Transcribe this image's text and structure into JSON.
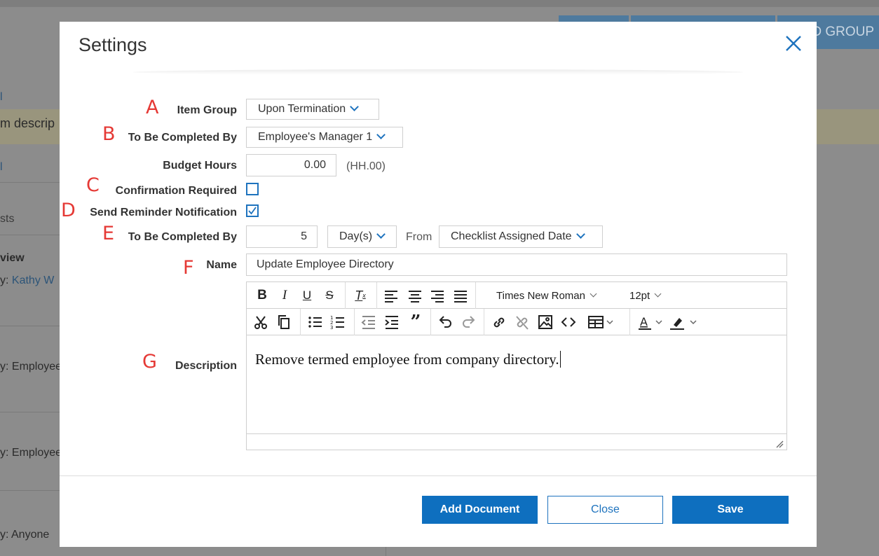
{
  "background": {
    "top_button_label": "D GROUP",
    "left_snippets": [
      "m descrip",
      "sts",
      "view",
      "y:",
      "Kathy W",
      "y: Employee",
      "y: Employee",
      "y: Anyone"
    ]
  },
  "modal": {
    "title": "Settings",
    "close_icon": "close-x-icon"
  },
  "annotations": [
    "A",
    "B",
    "C",
    "D",
    "E",
    "F",
    "G"
  ],
  "form": {
    "item_group": {
      "label": "Item Group",
      "value": "Upon Termination"
    },
    "completed_by": {
      "label": "To Be Completed By",
      "value": "Employee's Manager 1"
    },
    "budget_hours": {
      "label": "Budget Hours",
      "value": "0.00",
      "hint": "(HH.00)"
    },
    "confirmation_required": {
      "label": "Confirmation Required",
      "checked": false
    },
    "send_reminder": {
      "label": "Send Reminder Notification",
      "checked": true
    },
    "due": {
      "label": "To Be Completed By",
      "amount": "5",
      "unit": "Day(s)",
      "from_label": "From",
      "from_value": "Checklist Assigned Date"
    },
    "name": {
      "label": "Name",
      "value": "Update Employee Directory"
    },
    "description": {
      "label": "Description",
      "font_family": "Times New Roman",
      "font_size": "12pt",
      "content": "Remove termed employee from company directory."
    }
  },
  "footer": {
    "add_document": "Add Document",
    "close": "Close",
    "save": "Save"
  },
  "colors": {
    "accent": "#1e73be",
    "annotation": "#e53935",
    "primary_button": "#0e6fbf"
  }
}
